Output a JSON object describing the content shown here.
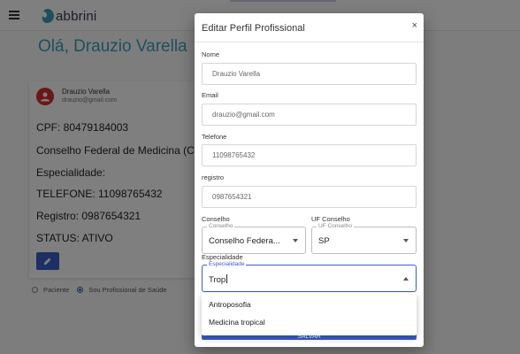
{
  "app": {
    "logo_text": "abbrini"
  },
  "greeting": "Olá, Drauzio Varella",
  "card": {
    "name": "Drauzio Varella",
    "email": "drauzio@gmail.com",
    "cpf": "CPF: 80479184003",
    "conselho": "Conselho Federal de Medicina (CRM)",
    "especialidade": "Especialidade:",
    "telefone": "TELEFONE: 11098765432",
    "registro": "Registro: 0987654321",
    "status": "STATUS: ATIVO"
  },
  "radios": [
    {
      "label": "Paciente",
      "checked": false
    },
    {
      "label": "Sou Profissional de Saúde",
      "checked": true
    }
  ],
  "modal": {
    "title": "Editar Perfil Profissional",
    "close": "×",
    "fields": {
      "nome_label": "Nome",
      "nome_value": "Drauzio Varella",
      "email_label": "Email",
      "email_value": "drauzio@gmail.com",
      "telefone_label": "Telefone",
      "telefone_value": "11098765432",
      "registro_label": "registro",
      "registro_value": "0987654321"
    },
    "conselho": {
      "label": "Conselho",
      "legend": "Conselho",
      "value": "Conselho Federa..."
    },
    "uf": {
      "label": "UF Conselho",
      "legend": "UF Conselho",
      "value": "SP"
    },
    "especialidade": {
      "label": "Especialidade",
      "legend": "Especialidade",
      "value": "Trop"
    },
    "options": [
      "Antroposofia",
      "Medicina tropical"
    ],
    "submit_label": "SALVAR"
  },
  "colors": {
    "primary": "#3b5ec6",
    "greeting": "#3aa0b8",
    "avatar": "#d2312e"
  }
}
